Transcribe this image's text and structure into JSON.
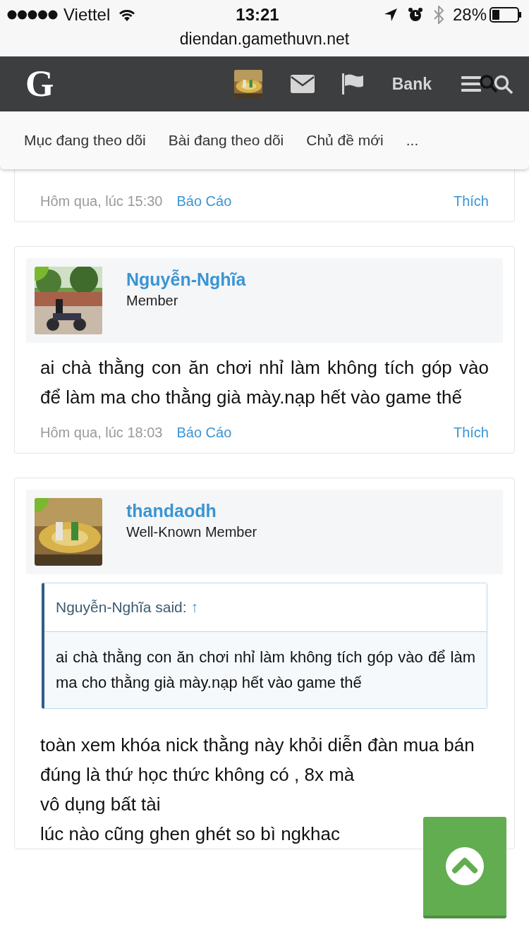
{
  "status_bar": {
    "carrier": "Viettel",
    "time": "13:21",
    "battery": "28%"
  },
  "address_bar": {
    "url": "diendan.gamethuvn.net"
  },
  "nav": {
    "logo": "G",
    "bank": "Bank"
  },
  "tabs": [
    "Mục đang theo dõi",
    "Bài đang theo dõi",
    "Chủ đề mới",
    "..."
  ],
  "posts": [
    {
      "time": "Hôm qua, lúc 15:30",
      "report": "Báo Cáo",
      "like": "Thích"
    },
    {
      "author": {
        "name": "Nguyễn-Nghĩa",
        "role": "Member",
        "online": true
      },
      "body": [
        "ai chà thằng con ăn chơi nhỉ làm không tích góp vào để làm ma cho thằng già mày.nạp hết vào game thế"
      ],
      "time": "Hôm qua, lúc 18:03",
      "report": "Báo Cáo",
      "like": "Thích"
    },
    {
      "author": {
        "name": "thandaodh",
        "role": "Well-Known Member",
        "online": true
      },
      "quote": {
        "attribution": "Nguyễn-Nghĩa said:",
        "arrow": "↑",
        "text": "ai chà thằng con ăn chơi nhỉ làm không tích góp vào để làm ma cho thằng già mày.nạp hết vào game thế"
      },
      "body": [
        "toàn xem khóa nick thằng này khỏi diễn đàn mua bán",
        "đúng là thứ học thức không có , 8x mà",
        "vô dụng bất tài",
        "lúc nào cũng ghen ghét so bì ngkhac"
      ]
    }
  ]
}
